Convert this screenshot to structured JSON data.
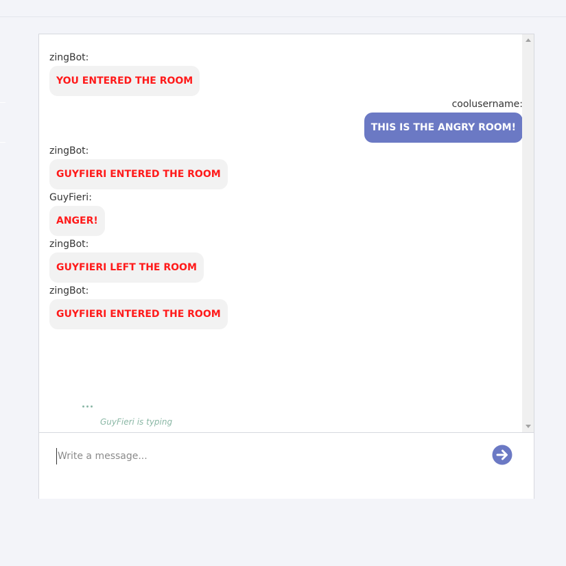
{
  "messages": [
    {
      "sender": "zingBot:",
      "text": "YOU ENTERED THE ROOM"
    },
    {
      "sender": "coolusername:",
      "text": "THIS IS THE ANGRY ROOM!"
    },
    {
      "sender": "zingBot:",
      "text": "GUYFIERI ENTERED THE ROOM"
    },
    {
      "sender": "GuyFieri:",
      "text": "ANGER!"
    },
    {
      "sender": "zingBot:",
      "text": "GUYFIERI LEFT THE ROOM"
    },
    {
      "sender": "zingBot:",
      "text": "GUYFIERI ENTERED THE ROOM"
    }
  ],
  "typing": {
    "dots": "...",
    "text": "GuyFieri is typing"
  },
  "composer": {
    "placeholder": "Write a message...",
    "value": ""
  },
  "icons": {
    "send": "arrow-right-circle-icon"
  },
  "colors": {
    "background": "#f3f4f9",
    "own_bubble": "#6b79c4",
    "other_bubble": "#f2f2f2",
    "other_text": "#ff1a1a",
    "typing": "#8ab7a5",
    "send_icon": "#6b79c4"
  }
}
